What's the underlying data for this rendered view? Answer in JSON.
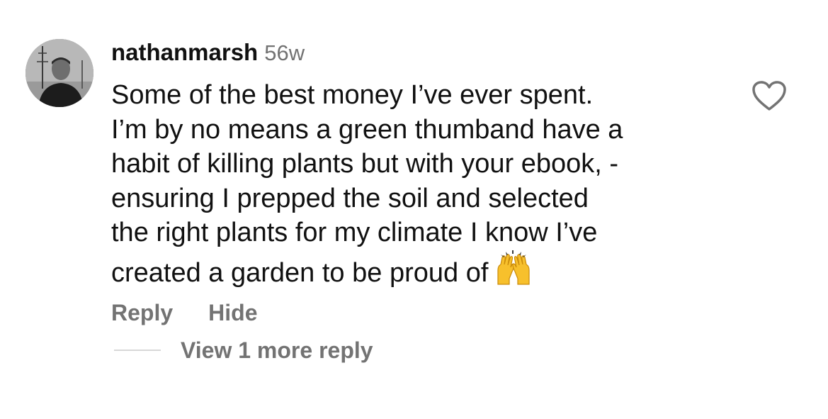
{
  "comment": {
    "username": "nathanmarsh",
    "timestamp": "56w",
    "lines": [
      "Some of the best money I’ve ever spent.",
      "I’m by no means a green thumband have a",
      "habit of killing plants but with your ebook, -",
      "ensuring I prepped the soil and selected",
      "the right plants for my climate I know I’ve",
      "created a garden to be proud of"
    ],
    "emoji": "raising-hands",
    "like_icon": "heart-outline-icon",
    "avatar_icon": "profile-photo"
  },
  "actions": {
    "reply": "Reply",
    "hide": "Hide"
  },
  "replies": {
    "view_more": "View 1 more reply"
  },
  "colors": {
    "text_primary": "#111111",
    "text_secondary": "#737373",
    "divider": "#d8d8d8",
    "emoji_yellow": "#f7c02c"
  }
}
